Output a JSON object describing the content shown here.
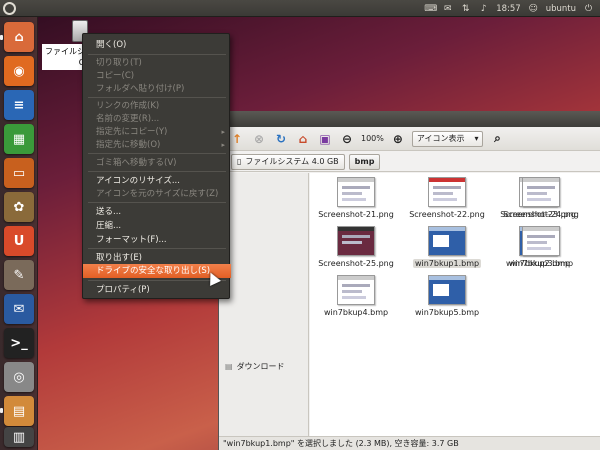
{
  "top_panel": {
    "time": "18:57",
    "user": "ubuntu"
  },
  "desktop": {
    "drive_label_line1": "ファイルシ",
    "drive_label_line2": "G"
  },
  "context_menu": {
    "items": [
      {
        "label": "開く(O)",
        "disabled": false
      },
      {
        "label": "切り取り(T)",
        "disabled": true
      },
      {
        "label": "コピー(C)",
        "disabled": true
      },
      {
        "label": "フォルダへ貼り付け(P)",
        "disabled": true
      },
      {
        "label": "リンクの作成(K)",
        "disabled": true
      },
      {
        "label": "名前の変更(R)...",
        "disabled": true
      },
      {
        "label": "指定先にコピー(Y)",
        "disabled": true
      },
      {
        "label": "指定先に移動(O)",
        "disabled": true
      },
      {
        "label": "ゴミ箱へ移動する(V)",
        "disabled": true
      },
      {
        "label": "アイコンのリサイズ...",
        "disabled": false
      },
      {
        "label": "アイコンを元のサイズに戻す(Z)",
        "disabled": true
      },
      {
        "label": "送る...",
        "disabled": false
      },
      {
        "label": "圧縮...",
        "disabled": false
      },
      {
        "label": "フォーマット(F)...",
        "disabled": false
      },
      {
        "label": "取り出す(E)",
        "disabled": false
      },
      {
        "label": "ドライブの安全な取り出し(S)",
        "disabled": false,
        "highlighted": true
      },
      {
        "label": "プロパティ(P)",
        "disabled": false
      }
    ]
  },
  "file_manager": {
    "zoom": "100%",
    "view_mode": "アイコン表示",
    "path": {
      "drive": "ファイルシステム 4.0 GB",
      "folder": "bmp"
    },
    "sidebar": {
      "downloads": "ダウンロード"
    },
    "files": [
      {
        "name": "Screenshot-21.png"
      },
      {
        "name": "Screenshot-22.png"
      },
      {
        "name": "Screenshot-23.png"
      },
      {
        "name": "Screenshot-24.png"
      },
      {
        "name": "Screenshot-25.png"
      },
      {
        "name": "win7bkup1.bmp",
        "selected": true
      },
      {
        "name": "win7bkup2.bmp"
      },
      {
        "name": "win7bkup3.bmp"
      },
      {
        "name": "win7bkup4.bmp"
      },
      {
        "name": "win7bkup5.bmp"
      }
    ],
    "status": "\"win7bkup1.bmp\" を選択しました (2.3 MB), 空き容量: 3.7 GB"
  },
  "colors": {
    "menu_bg": "#3c3b37",
    "menu_highlight": "#e9652f",
    "panel_bg": "#3b3a36"
  }
}
